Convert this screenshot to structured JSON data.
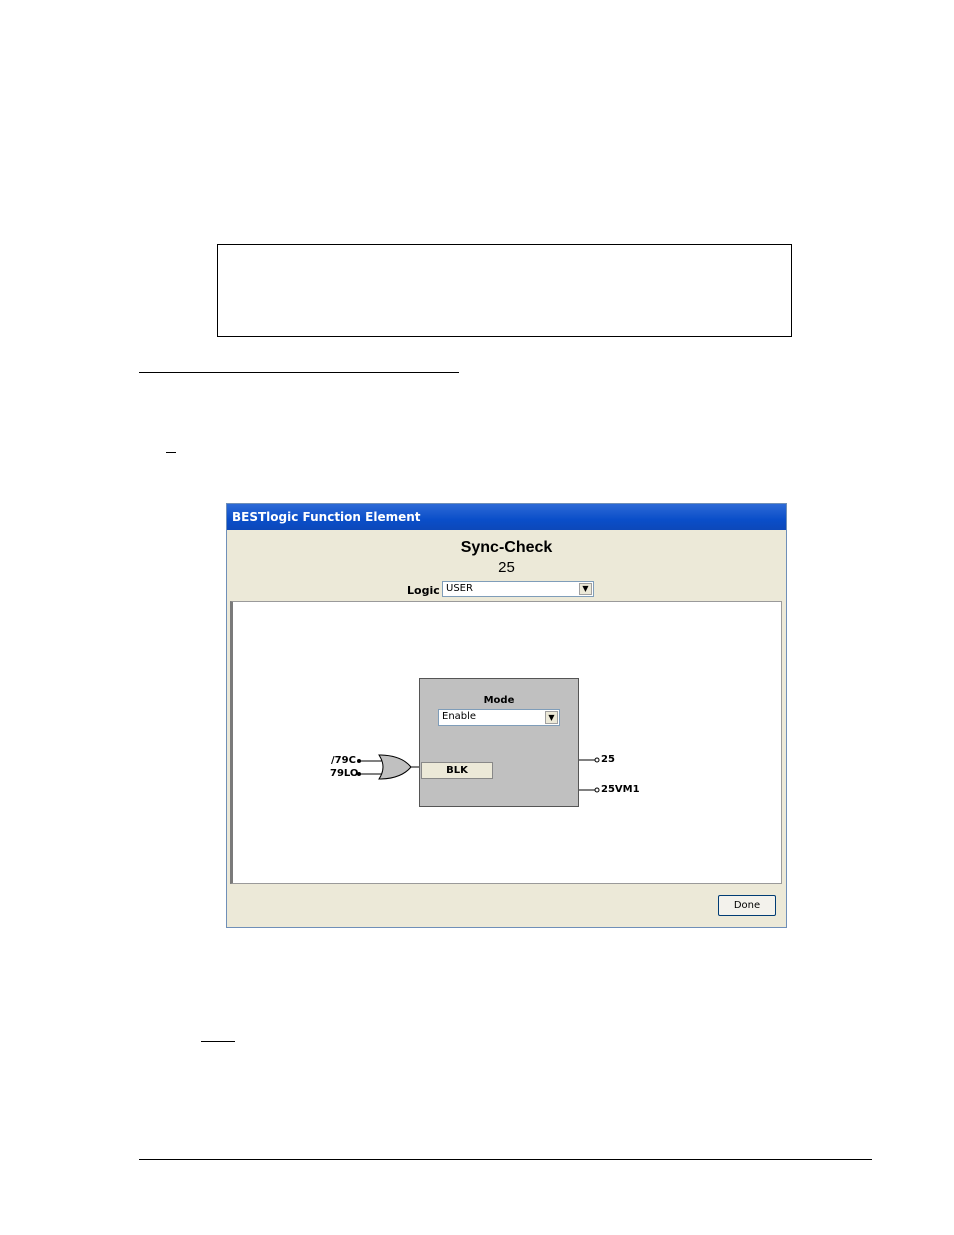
{
  "window": {
    "title": "BESTlogic Function Element",
    "heading": "Sync-Check",
    "subheading": "25",
    "logic_label": "Logic",
    "logic_value": "USER",
    "done_label": "Done"
  },
  "function_block": {
    "mode_label": "Mode",
    "mode_value": "Enable",
    "blk_label": "BLK",
    "inputs": [
      "/79C",
      "79LO"
    ],
    "outputs": [
      "25",
      "25VM1"
    ]
  },
  "icons": {
    "dropdown": "chevron-down-icon",
    "gate": "or-gate-icon"
  }
}
